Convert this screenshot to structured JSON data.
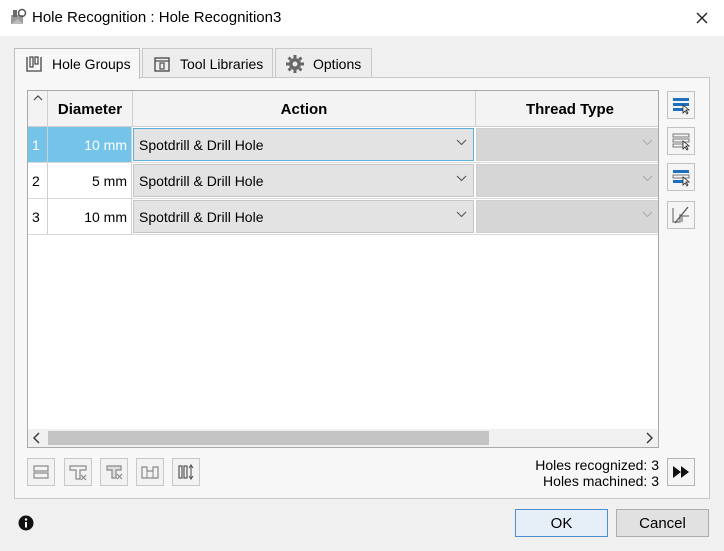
{
  "window": {
    "title": "Hole Recognition : Hole Recognition3"
  },
  "tabs": [
    {
      "label": "Hole Groups",
      "icon": "hole-groups-icon"
    },
    {
      "label": "Tool Libraries",
      "icon": "tool-library-icon"
    },
    {
      "label": "Options",
      "icon": "gear-icon"
    }
  ],
  "grid": {
    "columns": [
      "Diameter",
      "Action",
      "Thread Type"
    ],
    "rows": [
      {
        "num": "1",
        "diameter": "10 mm",
        "action": "Spotdrill & Drill Hole",
        "thread": ""
      },
      {
        "num": "2",
        "diameter": "5 mm",
        "action": "Spotdrill & Drill Hole",
        "thread": ""
      },
      {
        "num": "3",
        "diameter": "10 mm",
        "action": "Spotdrill & Drill Hole",
        "thread": ""
      }
    ]
  },
  "stats": {
    "recognized": "Holes recognized: 3",
    "machined": "Holes machined: 3"
  },
  "buttons": {
    "ok": "OK",
    "cancel": "Cancel"
  },
  "colors": {
    "selection": "#74c4ea",
    "accent": "#1e6fc0"
  }
}
